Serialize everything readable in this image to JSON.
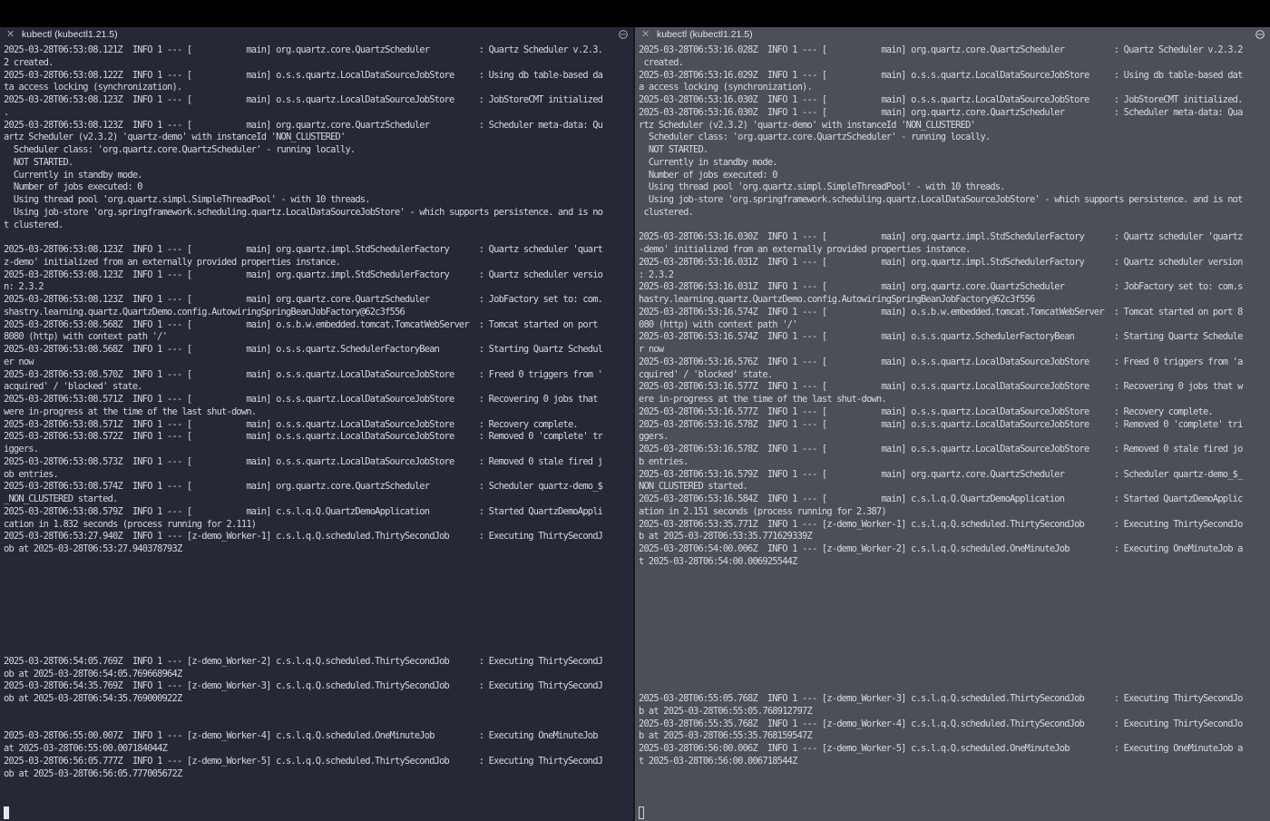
{
  "left_pane": {
    "tab_title": "kubectl (kubectl1.21.5)",
    "icons": {
      "close": "close-icon",
      "menu": "more-options-icon"
    },
    "log": "2025-03-28T06:53:08.121Z  INFO 1 --- [           main] org.quartz.core.QuartzScheduler          : Quartz Scheduler v.2.3.\n2 created.\n2025-03-28T06:53:08.122Z  INFO 1 --- [           main] o.s.s.quartz.LocalDataSourceJobStore     : Using db table-based da\nta access locking (synchronization).\n2025-03-28T06:53:08.123Z  INFO 1 --- [           main] o.s.s.quartz.LocalDataSourceJobStore     : JobStoreCMT initialized\n.\n2025-03-28T06:53:08.123Z  INFO 1 --- [           main] org.quartz.core.QuartzScheduler          : Scheduler meta-data: Qu\nartz Scheduler (v2.3.2) 'quartz-demo' with instanceId 'NON_CLUSTERED'\n  Scheduler class: 'org.quartz.core.QuartzScheduler' - running locally.\n  NOT STARTED.\n  Currently in standby mode.\n  Number of jobs executed: 0\n  Using thread pool 'org.quartz.simpl.SimpleThreadPool' - with 10 threads.\n  Using job-store 'org.springframework.scheduling.quartz.LocalDataSourceJobStore' - which supports persistence. and is no\nt clustered.\n\n2025-03-28T06:53:08.123Z  INFO 1 --- [           main] org.quartz.impl.StdSchedulerFactory      : Quartz scheduler 'quart\nz-demo' initialized from an externally provided properties instance.\n2025-03-28T06:53:08.123Z  INFO 1 --- [           main] org.quartz.impl.StdSchedulerFactory      : Quartz scheduler versio\nn: 2.3.2\n2025-03-28T06:53:08.123Z  INFO 1 --- [           main] org.quartz.core.QuartzScheduler          : JobFactory set to: com.\nshastry.learning.quartz.QuartzDemo.config.AutowiringSpringBeanJobFactory@62c3f556\n2025-03-28T06:53:08.568Z  INFO 1 --- [           main] o.s.b.w.embedded.tomcat.TomcatWebServer  : Tomcat started on port\n8080 (http) with context path '/'\n2025-03-28T06:53:08.568Z  INFO 1 --- [           main] o.s.s.quartz.SchedulerFactoryBean        : Starting Quartz Schedul\ner now\n2025-03-28T06:53:08.570Z  INFO 1 --- [           main] o.s.s.quartz.LocalDataSourceJobStore     : Freed 0 triggers from '\nacquired' / 'blocked' state.\n2025-03-28T06:53:08.571Z  INFO 1 --- [           main] o.s.s.quartz.LocalDataSourceJobStore     : Recovering 0 jobs that\nwere in-progress at the time of the last shut-down.\n2025-03-28T06:53:08.571Z  INFO 1 --- [           main] o.s.s.quartz.LocalDataSourceJobStore     : Recovery complete.\n2025-03-28T06:53:08.572Z  INFO 1 --- [           main] o.s.s.quartz.LocalDataSourceJobStore     : Removed 0 'complete' tr\niggers.\n2025-03-28T06:53:08.573Z  INFO 1 --- [           main] o.s.s.quartz.LocalDataSourceJobStore     : Removed 0 stale fired j\nob entries.\n2025-03-28T06:53:08.574Z  INFO 1 --- [           main] org.quartz.core.QuartzScheduler          : Scheduler quartz-demo_$\n_NON_CLUSTERED started.\n2025-03-28T06:53:08.579Z  INFO 1 --- [           main] c.s.l.q.Q.QuartzDemoApplication          : Started QuartzDemoAppli\ncation in 1.832 seconds (process running for 2.111)\n2025-03-28T06:53:27.940Z  INFO 1 --- [z-demo_Worker-1] c.s.l.q.Q.scheduled.ThirtySecondJob      : Executing ThirtySecondJ\nob at 2025-03-28T06:53:27.940378793Z\n\n\n\n\n\n\n\n\n2025-03-28T06:54:05.769Z  INFO 1 --- [z-demo_Worker-2] c.s.l.q.Q.scheduled.ThirtySecondJob      : Executing ThirtySecondJ\nob at 2025-03-28T06:54:05.769668964Z\n2025-03-28T06:54:35.769Z  INFO 1 --- [z-demo_Worker-3] c.s.l.q.Q.scheduled.ThirtySecondJob      : Executing ThirtySecondJ\nob at 2025-03-28T06:54:35.769000922Z\n\n\n2025-03-28T06:55:00.007Z  INFO 1 --- [z-demo_Worker-4] c.s.l.q.Q.scheduled.OneMinuteJob         : Executing OneMinuteJob\nat 2025-03-28T06:55:00.007184044Z\n2025-03-28T06:56:05.777Z  INFO 1 --- [z-demo_Worker-5] c.s.l.q.Q.scheduled.ThirtySecondJob      : Executing ThirtySecondJ\nob at 2025-03-28T06:56:05.777005672Z"
  },
  "right_pane": {
    "tab_title": "kubectl (kubectl1.21.5)",
    "icons": {
      "close": "close-icon",
      "menu": "more-options-icon"
    },
    "log": "2025-03-28T06:53:16.028Z  INFO 1 --- [           main] org.quartz.core.QuartzScheduler          : Quartz Scheduler v.2.3.2\n created.\n2025-03-28T06:53:16.029Z  INFO 1 --- [           main] o.s.s.quartz.LocalDataSourceJobStore     : Using db table-based dat\na access locking (synchronization).\n2025-03-28T06:53:16.030Z  INFO 1 --- [           main] o.s.s.quartz.LocalDataSourceJobStore     : JobStoreCMT initialized.\n2025-03-28T06:53:16.030Z  INFO 1 --- [           main] org.quartz.core.QuartzScheduler          : Scheduler meta-data: Qua\nrtz Scheduler (v2.3.2) 'quartz-demo' with instanceId 'NON_CLUSTERED'\n  Scheduler class: 'org.quartz.core.QuartzScheduler' - running locally.\n  NOT STARTED.\n  Currently in standby mode.\n  Number of jobs executed: 0\n  Using thread pool 'org.quartz.simpl.SimpleThreadPool' - with 10 threads.\n  Using job-store 'org.springframework.scheduling.quartz.LocalDataSourceJobStore' - which supports persistence. and is not\n clustered.\n\n2025-03-28T06:53:16.030Z  INFO 1 --- [           main] org.quartz.impl.StdSchedulerFactory      : Quartz scheduler 'quartz\n-demo' initialized from an externally provided properties instance.\n2025-03-28T06:53:16.031Z  INFO 1 --- [           main] org.quartz.impl.StdSchedulerFactory      : Quartz scheduler version\n: 2.3.2\n2025-03-28T06:53:16.031Z  INFO 1 --- [           main] org.quartz.core.QuartzScheduler          : JobFactory set to: com.s\nhastry.learning.quartz.QuartzDemo.config.AutowiringSpringBeanJobFactory@62c3f556\n2025-03-28T06:53:16.574Z  INFO 1 --- [           main] o.s.b.w.embedded.tomcat.TomcatWebServer  : Tomcat started on port 8\n080 (http) with context path '/'\n2025-03-28T06:53:16.574Z  INFO 1 --- [           main] o.s.s.quartz.SchedulerFactoryBean        : Starting Quartz Schedule\nr now\n2025-03-28T06:53:16.576Z  INFO 1 --- [           main] o.s.s.quartz.LocalDataSourceJobStore     : Freed 0 triggers from 'a\ncquired' / 'blocked' state.\n2025-03-28T06:53:16.577Z  INFO 1 --- [           main] o.s.s.quartz.LocalDataSourceJobStore     : Recovering 0 jobs that w\nere in-progress at the time of the last shut-down.\n2025-03-28T06:53:16.577Z  INFO 1 --- [           main] o.s.s.quartz.LocalDataSourceJobStore     : Recovery complete.\n2025-03-28T06:53:16.578Z  INFO 1 --- [           main] o.s.s.quartz.LocalDataSourceJobStore     : Removed 0 'complete' tri\nggers.\n2025-03-28T06:53:16.578Z  INFO 1 --- [           main] o.s.s.quartz.LocalDataSourceJobStore     : Removed 0 stale fired jo\nb entries.\n2025-03-28T06:53:16.579Z  INFO 1 --- [           main] org.quartz.core.QuartzScheduler          : Scheduler quartz-demo_$_\nNON_CLUSTERED started.\n2025-03-28T06:53:16.584Z  INFO 1 --- [           main] c.s.l.q.Q.QuartzDemoApplication          : Started QuartzDemoApplic\nation in 2.151 seconds (process running for 2.387)\n2025-03-28T06:53:35.771Z  INFO 1 --- [z-demo_Worker-1] c.s.l.q.Q.scheduled.ThirtySecondJob      : Executing ThirtySecondJo\nb at 2025-03-28T06:53:35.771629339Z\n2025-03-28T06:54:00.006Z  INFO 1 --- [z-demo_Worker-2] c.s.l.q.Q.scheduled.OneMinuteJob         : Executing OneMinuteJob a\nt 2025-03-28T06:54:00.006925544Z\n\n\n\n\n\n\n\n\n\n\n2025-03-28T06:55:05.768Z  INFO 1 --- [z-demo_Worker-3] c.s.l.q.Q.scheduled.ThirtySecondJob      : Executing ThirtySecondJo\nb at 2025-03-28T06:55:05.768912797Z\n2025-03-28T06:55:35.768Z  INFO 1 --- [z-demo_Worker-4] c.s.l.q.Q.scheduled.ThirtySecondJob      : Executing ThirtySecondJo\nb at 2025-03-28T06:55:35.768159547Z\n2025-03-28T06:56:00.006Z  INFO 1 --- [z-demo_Worker-5] c.s.l.q.Q.scheduled.OneMinuteJob         : Executing OneMinuteJob a\nt 2025-03-28T06:56:00.006718544Z"
  }
}
